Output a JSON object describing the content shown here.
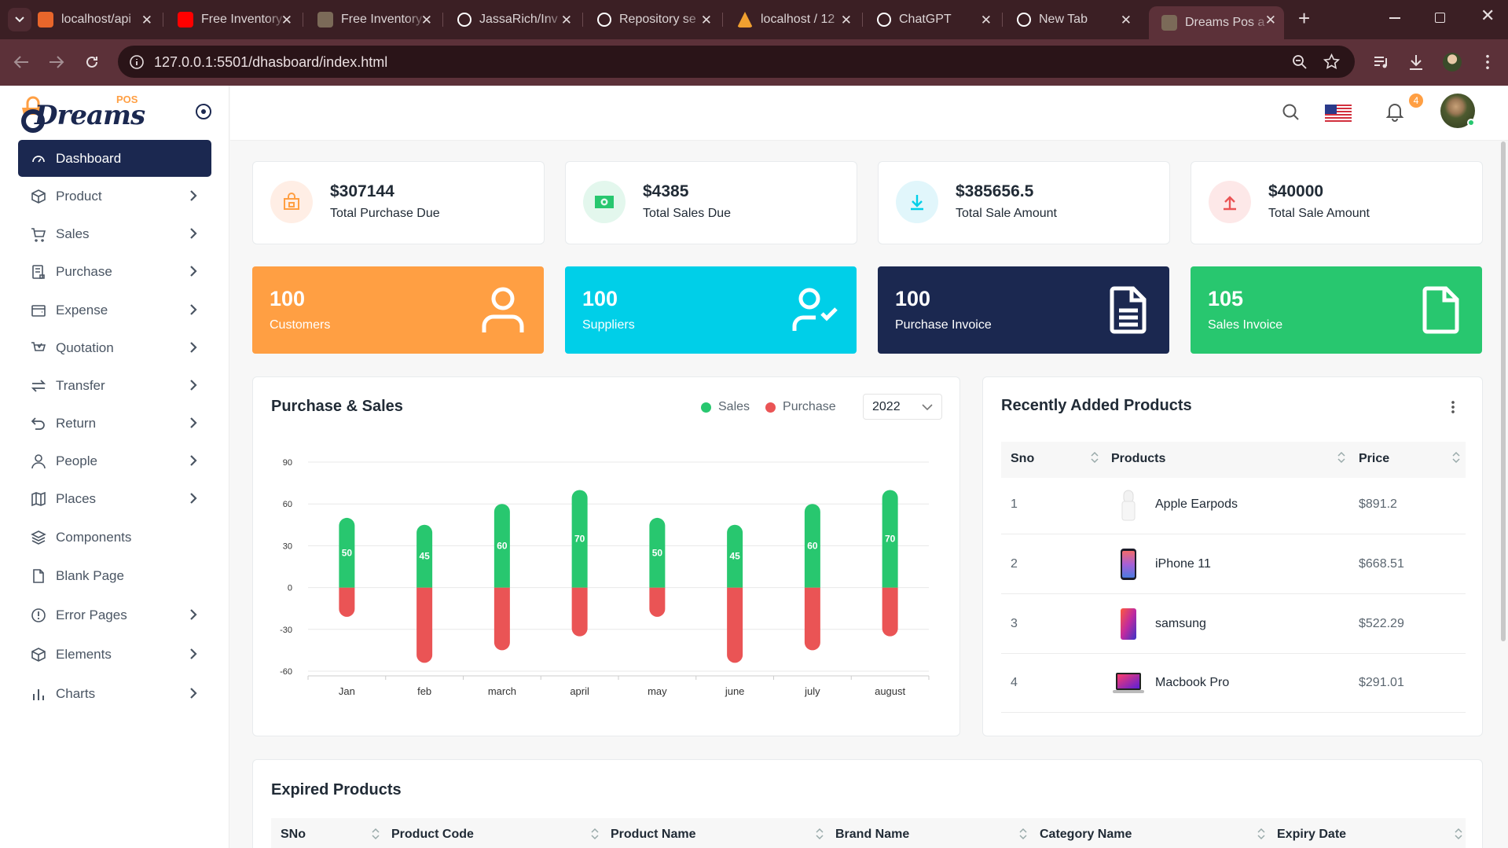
{
  "browser": {
    "tabs": [
      {
        "title": "localhost/api",
        "color": "#e8662b",
        "glyph": "⊠"
      },
      {
        "title": "Free Inventory",
        "color": "#ff0000",
        "glyph": "▶"
      },
      {
        "title": "Free Inventory",
        "color": "#7b6a58",
        "glyph": ""
      },
      {
        "title": "JassaRich/Inv",
        "color": "#ffffff",
        "glyph": "github"
      },
      {
        "title": "Repository se",
        "color": "#ffffff",
        "glyph": "github"
      },
      {
        "title": "localhost / 12",
        "color": "#f0a030",
        "glyph": "pma"
      },
      {
        "title": "ChatGPT",
        "color": "#ffffff",
        "glyph": "gpt"
      },
      {
        "title": "New Tab",
        "color": "#ffffff",
        "glyph": "chrome"
      },
      {
        "title": "Dreams Pos a",
        "color": "#7b6a58",
        "glyph": ""
      }
    ],
    "url": "127.0.0.1:5501/dhasboard/index.html"
  },
  "logo": {
    "text": "Dreams",
    "badge": "POS"
  },
  "sidebar": {
    "items": [
      {
        "label": "Dashboard",
        "icon": "dashboard-icon",
        "active": true,
        "arrow": false
      },
      {
        "label": "Product",
        "icon": "box-icon",
        "arrow": true
      },
      {
        "label": "Sales",
        "icon": "cart-icon",
        "arrow": true
      },
      {
        "label": "Purchase",
        "icon": "purchase-icon",
        "arrow": true
      },
      {
        "label": "Expense",
        "icon": "expense-icon",
        "arrow": true
      },
      {
        "label": "Quotation",
        "icon": "quotation-icon",
        "arrow": true
      },
      {
        "label": "Transfer",
        "icon": "transfer-icon",
        "arrow": true
      },
      {
        "label": "Return",
        "icon": "return-icon",
        "arrow": true
      },
      {
        "label": "People",
        "icon": "user-icon",
        "arrow": true
      },
      {
        "label": "Places",
        "icon": "map-icon",
        "arrow": true
      },
      {
        "label": "Components",
        "icon": "layers-icon",
        "arrow": false
      },
      {
        "label": "Blank Page",
        "icon": "file-icon",
        "arrow": false
      },
      {
        "label": "Error Pages",
        "icon": "alert-icon",
        "arrow": true
      },
      {
        "label": "Elements",
        "icon": "box-icon",
        "arrow": true
      },
      {
        "label": "Charts",
        "icon": "chart-icon",
        "arrow": true
      }
    ]
  },
  "topbar": {
    "notification_count": "4"
  },
  "stats": [
    {
      "value": "$307144",
      "label": "Total Purchase Due",
      "bg": "#ffeee5",
      "fg": "#ff9f43"
    },
    {
      "value": "$4385",
      "label": "Total Sales Due",
      "bg": "#e3f7ed",
      "fg": "#28c76f"
    },
    {
      "value": "$385656.5",
      "label": "Total Sale Amount",
      "bg": "#e1f6fb",
      "fg": "#00cfe8"
    },
    {
      "value": "$40000",
      "label": "Total Sale Amount",
      "bg": "#fde8e8",
      "fg": "#ea5455"
    }
  ],
  "counts": [
    {
      "value": "100",
      "label": "Customers",
      "color": "#ff9f43"
    },
    {
      "value": "100",
      "label": "Suppliers",
      "color": "#00cfe8"
    },
    {
      "value": "100",
      "label": "Purchase Invoice",
      "color": "#1b2850"
    },
    {
      "value": "105",
      "label": "Sales Invoice",
      "color": "#28c76f"
    }
  ],
  "purchase_sales": {
    "title": "Purchase & Sales",
    "legend": [
      "Sales",
      "Purchase"
    ],
    "year": "2022"
  },
  "chart_data": {
    "type": "bar",
    "categories": [
      "Jan",
      "feb",
      "march",
      "april",
      "may",
      "june",
      "july",
      "august"
    ],
    "series": [
      {
        "name": "Sales",
        "values": [
          50,
          45,
          60,
          70,
          50,
          45,
          60,
          70
        ],
        "color": "#28c76f"
      },
      {
        "name": "Purchase",
        "values": [
          -21,
          -54,
          -45,
          -35,
          -21,
          -54,
          -45,
          -35
        ],
        "color": "#ea5455"
      }
    ],
    "y_ticks": [
      90,
      60,
      30,
      0,
      -30,
      -60
    ],
    "ylim": [
      -60,
      90
    ],
    "data_labels": "sales values shown inside bars",
    "grid": true,
    "legend_position": "top-right"
  },
  "recent_products": {
    "title": "Recently Added Products",
    "columns": [
      "Sno",
      "Products",
      "Price"
    ],
    "rows": [
      {
        "sno": "1",
        "name": "Apple Earpods",
        "price": "$891.2",
        "thumb": "earpods"
      },
      {
        "sno": "2",
        "name": "iPhone 11",
        "price": "$668.51",
        "thumb": "iphone"
      },
      {
        "sno": "3",
        "name": "samsung",
        "price": "$522.29",
        "thumb": "samsung"
      },
      {
        "sno": "4",
        "name": "Macbook Pro",
        "price": "$291.01",
        "thumb": "macbook"
      }
    ]
  },
  "expired_products": {
    "title": "Expired Products",
    "columns": [
      "SNo",
      "Product Code",
      "Product Name",
      "Brand Name",
      "Category Name",
      "Expiry Date"
    ]
  }
}
